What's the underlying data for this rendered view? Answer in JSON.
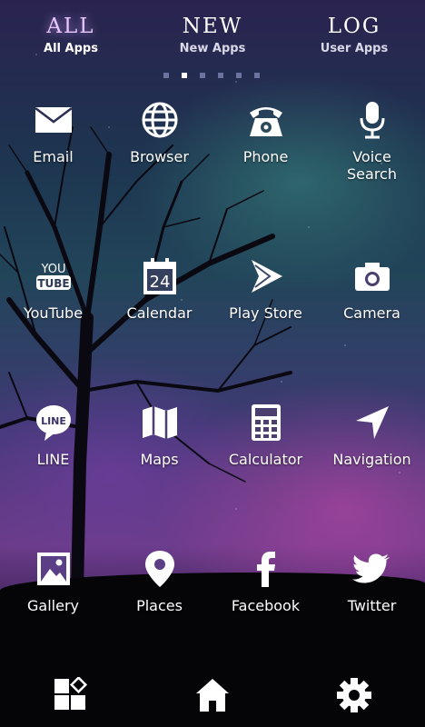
{
  "tabs": [
    {
      "title": "ALL",
      "subtitle": "All Apps"
    },
    {
      "title": "NEW",
      "subtitle": "New Apps"
    },
    {
      "title": "LOG",
      "subtitle": "User Apps"
    }
  ],
  "page_indicator": {
    "count": 6,
    "active": 1
  },
  "apps": [
    {
      "label": "Email",
      "icon": "envelope-icon"
    },
    {
      "label": "Browser",
      "icon": "globe-icon"
    },
    {
      "label": "Phone",
      "icon": "telephone-icon"
    },
    {
      "label": "Voice\nSearch",
      "icon": "microphone-icon"
    },
    {
      "label": "YouTube",
      "icon": "youtube-icon",
      "icon_text": [
        "YOU",
        "TUBE"
      ]
    },
    {
      "label": "Calendar",
      "icon": "calendar-icon",
      "icon_text": "24"
    },
    {
      "label": "Play Store",
      "icon": "play-store-icon"
    },
    {
      "label": "Camera",
      "icon": "camera-icon"
    },
    {
      "label": "LINE",
      "icon": "line-icon",
      "icon_text": "LINE"
    },
    {
      "label": "Maps",
      "icon": "map-icon"
    },
    {
      "label": "Calculator",
      "icon": "calculator-icon"
    },
    {
      "label": "Navigation",
      "icon": "navigation-arrow-icon"
    },
    {
      "label": "Gallery",
      "icon": "picture-icon"
    },
    {
      "label": "Places",
      "icon": "map-pin-icon"
    },
    {
      "label": "Facebook",
      "icon": "facebook-icon"
    },
    {
      "label": "Twitter",
      "icon": "twitter-bird-icon"
    }
  ],
  "dock": [
    {
      "icon": "apps-grid-icon"
    },
    {
      "icon": "home-icon"
    },
    {
      "icon": "settings-gear-icon"
    }
  ],
  "colors": {
    "active_tab": "#e8c6ff",
    "text": "#ffffff",
    "ground": "#050407"
  }
}
